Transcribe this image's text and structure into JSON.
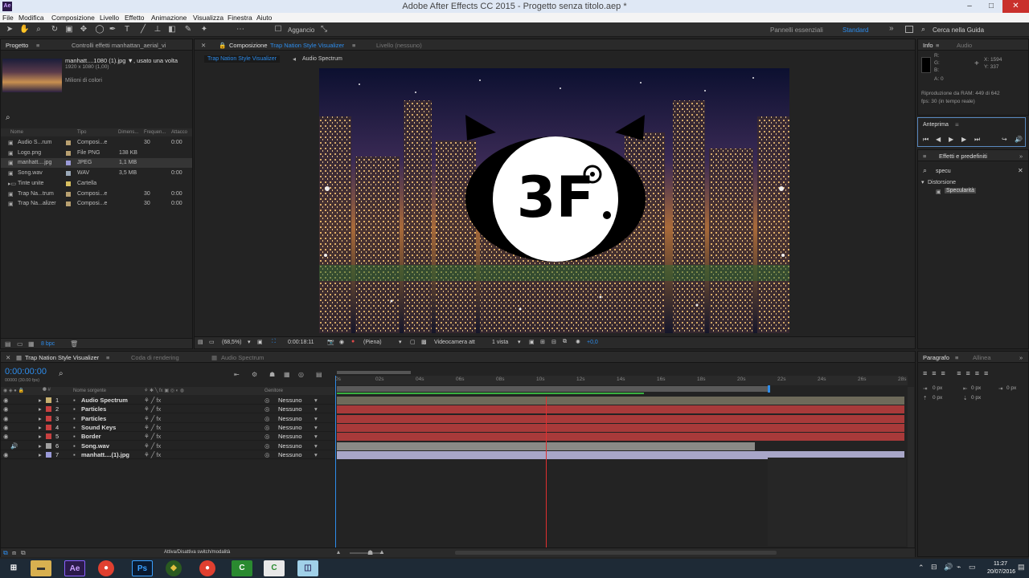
{
  "app": {
    "title": "Adobe After Effects CC 2015 - Progetto senza titolo.aep *"
  },
  "menu": [
    "File",
    "Modifica",
    "Composizione",
    "Livello",
    "Effetto",
    "Animazione",
    "Visualizza",
    "Finestra",
    "Aiuto"
  ],
  "toolbar": {
    "snap": "Aggancio",
    "workspace1": "Pannelli essenziali",
    "workspace2": "Standard",
    "search": "Cerca nella Guida"
  },
  "project": {
    "tab1": "Progetto",
    "tab2": "Controlli effetti manhattan_aerial_vi",
    "file_name": "manhatt....1080 (1).jpg ▼, usato una volta",
    "file_dims": "1920 x 1080 (1,00)",
    "file_colors": "Milioni di colori",
    "headers": [
      "Nome",
      "Tipo",
      "Dimens...",
      "Frequen...",
      "Attacco"
    ],
    "items": [
      {
        "name": "Audio S...rum",
        "type": "Composi...e",
        "size": "",
        "freq": "30",
        "in": "0:00",
        "color": "#b8a070"
      },
      {
        "name": "Logo.png",
        "type": "File PNG",
        "size": "138 KB",
        "freq": "",
        "in": "",
        "color": "#b8a070"
      },
      {
        "name": "manhatt....jpg",
        "type": "JPEG",
        "size": "1,1 MB",
        "freq": "",
        "in": "",
        "color": "#9a9ad8"
      },
      {
        "name": "Song.wav",
        "type": "WAV",
        "size": "3,5 MB",
        "freq": "",
        "in": "0:00",
        "color": "#9aa8b8"
      },
      {
        "name": "Tinte unite",
        "type": "Cartella",
        "size": "",
        "freq": "",
        "in": "",
        "color": "#d8c060"
      },
      {
        "name": "Trap Na...trum",
        "type": "Composi...e",
        "size": "",
        "freq": "30",
        "in": "0:00",
        "color": "#b8a070"
      },
      {
        "name": "Trap Na...alizer",
        "type": "Composi...e",
        "size": "",
        "freq": "30",
        "in": "0:00",
        "color": "#b8a070"
      }
    ],
    "bpc": "8 bpc"
  },
  "comp": {
    "tab_prefix": "Composizione",
    "tab_name": "Trap Nation Style Visualizer",
    "layer_tab": "Livello (nessuno)",
    "sub1": "Trap Nation Style Visualizer",
    "sub2": "Audio Spectrum",
    "zoom": "(68,5%)",
    "time": "0:00:18:11",
    "quality": "(Piena)",
    "camera": "Videocamera att",
    "views": "1 vista",
    "exposure": "+0,0"
  },
  "info": {
    "tab1": "Info",
    "tab2": "Audio",
    "r": "R:",
    "g": "G:",
    "b": "B:",
    "a": "A: 0",
    "x": "X: 1594",
    "y": "Y: 337",
    "ram": "Riproduzione da RAM: 449 di 642",
    "fps": "fps: 30 (in tempo reale)"
  },
  "preview": {
    "tab": "Anteprima"
  },
  "effects": {
    "tab": "Effetti e predefiniti",
    "search": "specu",
    "category": "Distorsione",
    "item": "Specularità"
  },
  "paragraph": {
    "tab1": "Paragrafo",
    "tab2": "Allinea",
    "px": [
      "0 px",
      "0 px",
      "0 px",
      "0 px",
      "0 px"
    ]
  },
  "timeline": {
    "tab1": "Trap Nation Style Visualizer",
    "tab2": "Coda di rendering",
    "tab3": "Audio Spectrum",
    "timecode": "0:00:00:00",
    "fps": "00000 (30.00 fps)",
    "col_name": "Nome sorgente",
    "col_parent": "Genitore",
    "ticks": [
      "0s",
      "02s",
      "04s",
      "06s",
      "08s",
      "10s",
      "12s",
      "14s",
      "16s",
      "18s",
      "20s",
      "22s",
      "24s",
      "26s",
      "28s"
    ],
    "layers": [
      {
        "num": "1",
        "name": "Audio Spectrum",
        "parent": "Nessuno",
        "label": "#c8b070",
        "bar": "#6e6a5a"
      },
      {
        "num": "2",
        "name": "Particles",
        "parent": "Nessuno",
        "label": "#c84040",
        "bar": "#a83a3a"
      },
      {
        "num": "3",
        "name": "Particles",
        "parent": "Nessuno",
        "label": "#c84040",
        "bar": "#a83a3a"
      },
      {
        "num": "4",
        "name": "Sound Keys",
        "parent": "Nessuno",
        "label": "#c84040",
        "bar": "#a83a3a"
      },
      {
        "num": "5",
        "name": "Border",
        "parent": "Nessuno",
        "label": "#c84040",
        "bar": "#a83a3a"
      },
      {
        "num": "6",
        "name": "Song.wav",
        "parent": "Nessuno",
        "label": "#a0a0a0",
        "bar": "#8a8a86"
      },
      {
        "num": "7",
        "name": "manhatt....(1).jpg",
        "parent": "Nessuno",
        "label": "#9a9ad8",
        "bar": "#a8a6c8"
      }
    ],
    "footer": "Attiva/Disattiva switch/modalità"
  },
  "taskbar": {
    "time": "11:27",
    "date": "20/07/2016"
  },
  "colors": {
    "accent": "#2d8ceb"
  }
}
